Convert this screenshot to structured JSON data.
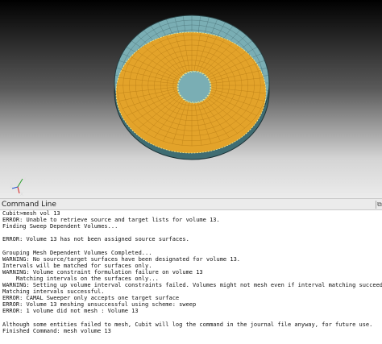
{
  "viewport": {
    "colors": {
      "background_top": "#000000",
      "background_bottom": "#ececec",
      "disc_surface": "#7aaeb4",
      "mesh_highlight": "#e3a32a",
      "mesh_lines": "#2e4d52",
      "highlight_outline": "#f4f09a"
    },
    "triad": {
      "y_label": "Y",
      "z_label": "Z",
      "x_label": "X"
    }
  },
  "command_panel": {
    "title": "Command Line",
    "undock_icon": "undock-icon",
    "lines": [
      "Cubit>mesh vol 13",
      "ERROR: Unable to retrieve source and target lists for volume 13.",
      "Finding Sweep Dependent Volumes...",
      "",
      "ERROR: Volume 13 has not been assigned source surfaces.",
      "",
      "Grouping Mesh Dependent Volumes Completed...",
      "WARNING: No source/target surfaces have been designated for volume 13.",
      "Intervals will be matched for surfaces only.",
      "WARNING: Volume constraint formulation failure on volume 13",
      "    Matching intervals on the surfaces only...",
      "WARNING: Setting up volume interval constraints failed. Volumes might not mesh even if interval matching succeeds on the remaining constraints.",
      "Matching intervals successful.",
      "ERROR: CAMAL Sweeper only accepts one target surface",
      "ERROR: Volume 13 meshing unsuccessful using scheme: sweep",
      "ERROR: 1 volume did not mesh : Volume 13",
      "",
      "Although some entities failed to mesh, Cubit will log the command in the journal file anyway, for future use.",
      "Finished Command: mesh volume 13"
    ]
  }
}
